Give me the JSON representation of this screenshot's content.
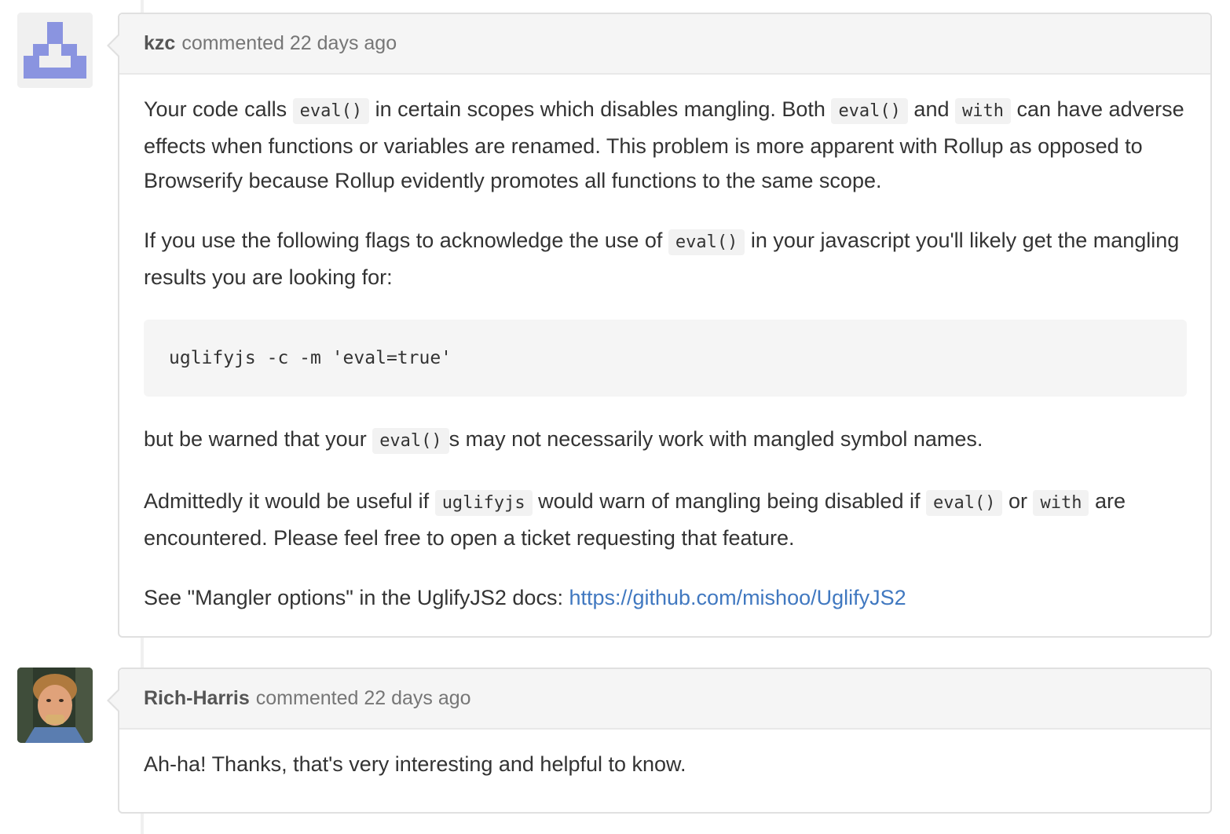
{
  "comments": [
    {
      "author": "kzc",
      "action": "commented",
      "time": "22 days ago",
      "avatar_color": "#8a94e0",
      "body": {
        "p1": {
          "t1": "Your code calls ",
          "c1": "eval()",
          "t2": " in certain scopes which disables mangling. Both ",
          "c2": "eval()",
          "t3": " and ",
          "c3": "with",
          "t4": " can have adverse effects when functions or variables are renamed. This problem is more apparent with Rollup as opposed to Browserify because Rollup evidently promotes all functions to the same scope."
        },
        "p2": {
          "t1": "If you use the following flags to acknowledge the use of ",
          "c1": "eval()",
          "t2": " in your javascript you'll likely get the mangling results you are looking for:"
        },
        "code_block": "uglifyjs -c -m 'eval=true'",
        "p3": {
          "t1": "but be warned that your ",
          "c1": "eval()",
          "t2": "s may not necessarily work with mangled symbol names."
        },
        "p4": {
          "t1": "Admittedly it would be useful if ",
          "c1": "uglifyjs",
          "t2": " would warn of mangling being disabled if ",
          "c2": "eval()",
          "t3": " or ",
          "c3": "with",
          "t4": " are encountered. Please feel free to open a ticket requesting that feature."
        },
        "p5": {
          "t1": "See \"Mangler options\" in the UglifyJS2 docs: ",
          "link": "https://github.com/mishoo/UglifyJS2"
        }
      }
    },
    {
      "author": "Rich-Harris",
      "action": "commented",
      "time": "22 days ago",
      "body": {
        "p1": "Ah-ha! Thanks, that's very interesting and helpful to know."
      }
    }
  ],
  "colors": {
    "link": "#4078c0",
    "header_bg": "#f5f5f5",
    "border": "#e0e0e0"
  }
}
